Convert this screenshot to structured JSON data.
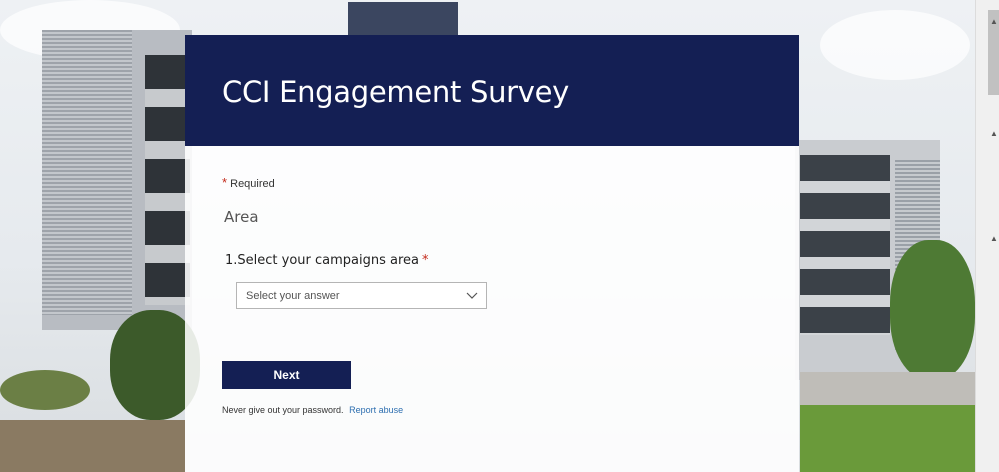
{
  "form": {
    "title": "CCI Engagement Survey",
    "required_asterisk": "*",
    "required_label": "Required",
    "section_title": "Area",
    "questions": [
      {
        "number": "1.",
        "label": "Select your campaigns area",
        "required_asterisk": "*",
        "select_placeholder": "Select your answer"
      }
    ],
    "next_label": "Next",
    "footer_text": "Never give out your password.",
    "report_link": "Report abuse"
  },
  "colors": {
    "header_bg": "#141f54",
    "button_bg": "#141f54",
    "required": "#c42b1c",
    "link": "#2e6fb0"
  },
  "icons": {
    "dropdown": "chevron-down-icon",
    "scroll_up": "scroll-up-arrow-icon"
  }
}
